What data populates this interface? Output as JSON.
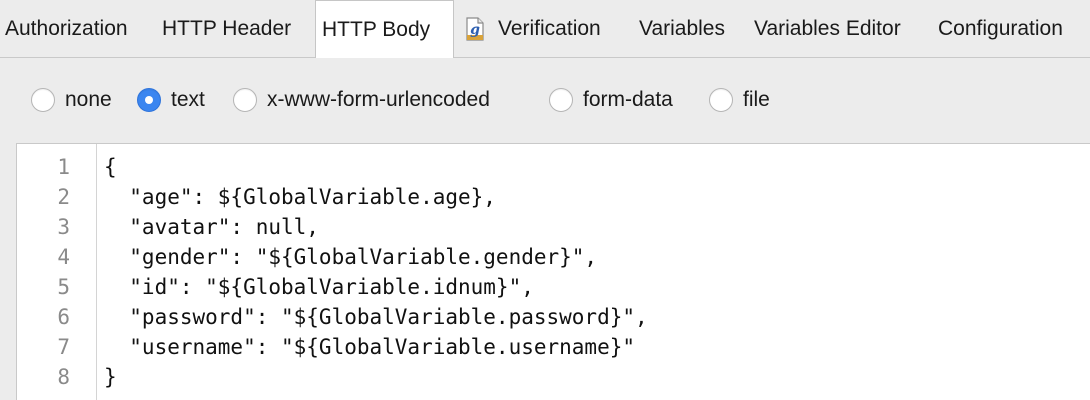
{
  "tabs": [
    {
      "label": "Authorization",
      "active": false
    },
    {
      "label": "HTTP Header",
      "active": false
    },
    {
      "label": "HTTP Body",
      "active": true
    },
    {
      "label": "Verification",
      "active": false,
      "icon": "groovy-file-icon"
    },
    {
      "label": "Variables",
      "active": false
    },
    {
      "label": "Variables Editor",
      "active": false
    },
    {
      "label": "Configuration",
      "active": false
    }
  ],
  "body_types": [
    {
      "label": "none",
      "checked": false
    },
    {
      "label": "text",
      "checked": true
    },
    {
      "label": "x-www-form-urlencoded",
      "checked": false
    },
    {
      "label": "form-data",
      "checked": false
    },
    {
      "label": "file",
      "checked": false
    }
  ],
  "editor": {
    "line_numbers": [
      "1",
      "2",
      "3",
      "4",
      "5",
      "6",
      "7",
      "8"
    ],
    "lines": [
      "{",
      "  \"age\": ${GlobalVariable.age},",
      "  \"avatar\": null,",
      "  \"gender\": \"${GlobalVariable.gender}\",",
      "  \"id\": \"${GlobalVariable.idnum}\",",
      "  \"password\": \"${GlobalVariable.password}\",",
      "  \"username\": \"${GlobalVariable.username}\"",
      "}"
    ]
  },
  "colors": {
    "accent": "#3b86f0",
    "background": "#ececec",
    "editor_background": "#ffffff",
    "line_number": "#8a8a8a"
  }
}
